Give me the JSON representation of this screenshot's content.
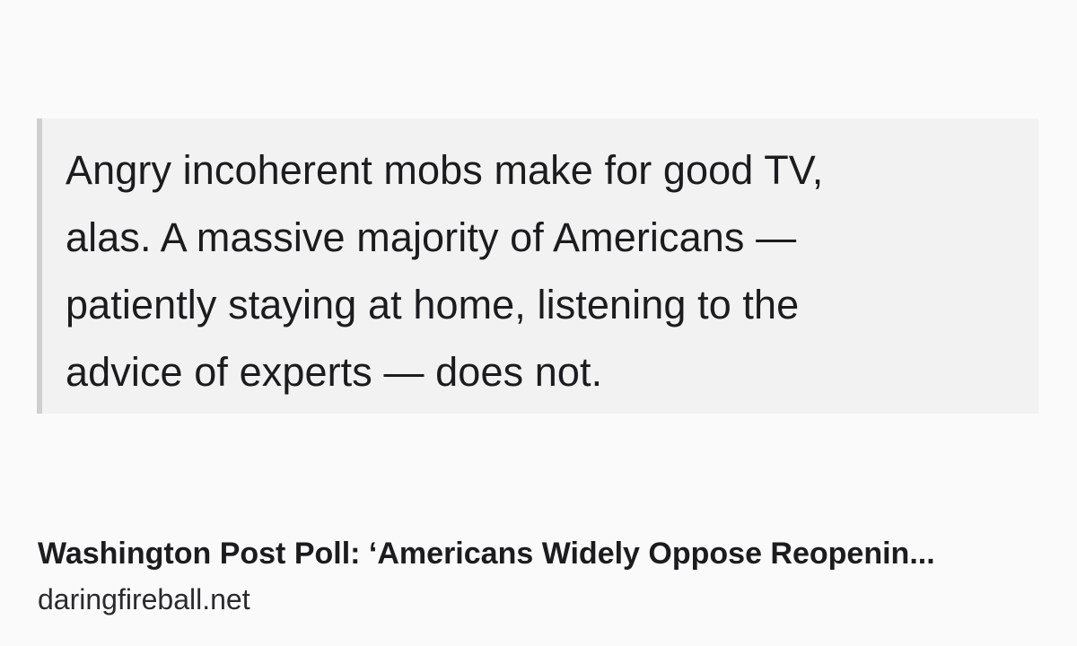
{
  "quote": {
    "lines": [
      "Angry incoherent mobs make for good TV,",
      "alas. A massive majority of Americans —",
      "patiently staying at home, listening to the",
      "advice of experts — does not."
    ]
  },
  "link_preview": {
    "title": "Washington Post Poll: ‘Americans Widely Oppose Reopenin...",
    "domain": "daringfireball.net"
  }
}
